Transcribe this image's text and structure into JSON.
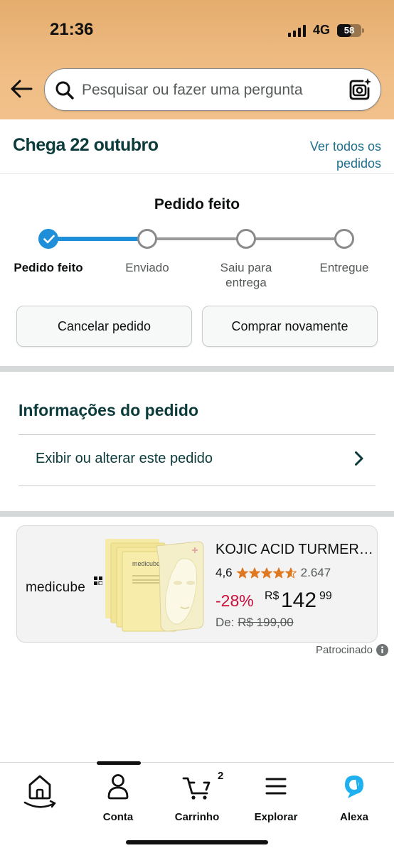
{
  "status_bar": {
    "time": "21:36",
    "network": "4G",
    "battery": "58",
    "battery_level": 0.58
  },
  "search": {
    "placeholder": "Pesquisar ou fazer uma pergunta"
  },
  "arrival": {
    "title": "Chega 22 outubro",
    "see_all_line1": "Ver todos os",
    "see_all_line2": "pedidos"
  },
  "progress": {
    "title": "Pedido feito",
    "steps": [
      {
        "label_line1": "Pedido feito",
        "label_line2": "",
        "done": true
      },
      {
        "label_line1": "Enviado",
        "label_line2": "",
        "done": false
      },
      {
        "label_line1": "Saiu para",
        "label_line2": "entrega",
        "done": false
      },
      {
        "label_line1": "Entregue",
        "label_line2": "",
        "done": false
      }
    ],
    "completed_fraction": 0.333
  },
  "actions": {
    "cancel_label": "Cancelar pedido",
    "buy_again_label": "Comprar novamente"
  },
  "order_info": {
    "title": "Informações do pedido",
    "view_edit_label": "Exibir ou alterar este pedido"
  },
  "ad": {
    "brand": "medicube",
    "product_brand_text": "medicube",
    "title": "KOJIC ACID TURMERIC…",
    "rating": "4,6",
    "rating_stars": 4.6,
    "review_count": "2.647",
    "discount": "-28%",
    "currency": "R$",
    "price_whole": "142",
    "price_fraction": "99",
    "list_price_prefix": "De:",
    "list_price": "R$ 199,00",
    "sponsored_label": "Patrocinado"
  },
  "bottom_nav": {
    "items": [
      {
        "label": "",
        "icon": "home-icon"
      },
      {
        "label": "Conta",
        "icon": "account-icon"
      },
      {
        "label": "Carrinho",
        "icon": "cart-icon"
      },
      {
        "label": "Explorar",
        "icon": "menu-icon"
      },
      {
        "label": "Alexa",
        "icon": "alexa-icon"
      }
    ],
    "cart_count": "2"
  },
  "colors": {
    "header_bg": "#efbd85",
    "link": "#1f6f8b",
    "progress_done": "#1e8fd8",
    "discount": "#cc0c39",
    "star": "#de7921",
    "heading_teal": "#0b3b3b",
    "alexa": "#1fb0f0"
  }
}
